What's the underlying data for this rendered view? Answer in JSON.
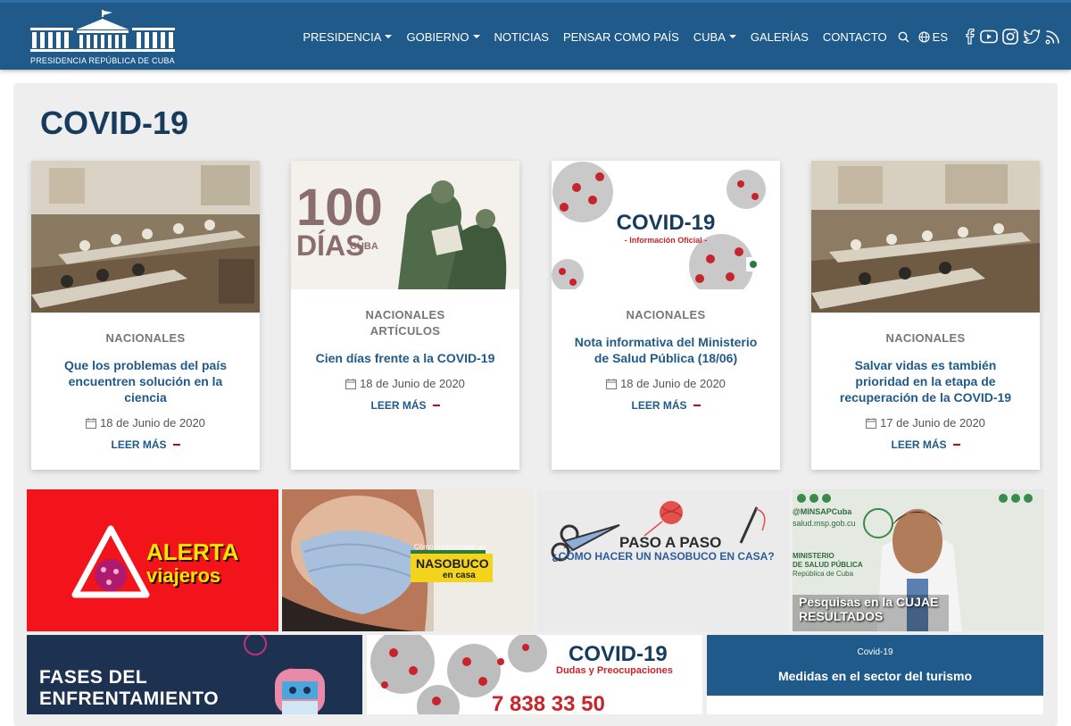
{
  "header": {
    "logo_text": "PRESIDENCIA REPÚBLICA DE CUBA",
    "nav": [
      {
        "label": "PRESIDENCIA",
        "dropdown": true
      },
      {
        "label": "GOBIERNO",
        "dropdown": true
      },
      {
        "label": "NOTICIAS",
        "dropdown": false
      },
      {
        "label": "PENSAR COMO PAÍS",
        "dropdown": false
      },
      {
        "label": "CUBA",
        "dropdown": true
      },
      {
        "label": "GALERÍAS",
        "dropdown": false
      },
      {
        "label": "CONTACTO",
        "dropdown": false
      }
    ],
    "lang": "ES",
    "icons": [
      "search-icon",
      "globe-icon",
      "facebook-icon",
      "youtube-icon",
      "instagram-icon",
      "twitter-icon",
      "rss-icon"
    ]
  },
  "page": {
    "title": "COVID-19"
  },
  "cards": [
    {
      "category": "NACIONALES",
      "category2": "",
      "title": "Que los problemas del país encuentren solución en la ciencia",
      "date": "18 de Junio de 2020",
      "more": "LEER MÁS"
    },
    {
      "category": "NACIONALES",
      "category2": "ARTÍCULOS",
      "title": "Cien días frente a la COVID-19",
      "date": "18 de Junio de 2020",
      "more": "LEER MÁS",
      "image_text": {
        "big": "100",
        "days": "DÍAS",
        "country": "CUBA"
      }
    },
    {
      "category": "NACIONALES",
      "category2": "",
      "title": "Nota informativa del Ministerio de Salud Pública (18/06)",
      "date": "18 de Junio de 2020",
      "more": "LEER MÁS",
      "image_text": {
        "big": "COVID-19",
        "sub": "- Información Oficial -"
      }
    },
    {
      "category": "NACIONALES",
      "category2": "",
      "title": "Salvar vidas es también prioridad en la etapa de recuperación de la COVID-19",
      "date": "17 de Junio de 2020",
      "more": "LEER MÁS"
    }
  ],
  "banners": {
    "alerta": {
      "line1": "ALERTA",
      "line2": "viajeros"
    },
    "nasobuco": {
      "small": "Cómo confeccionar un",
      "big": "NASOBUCO",
      "sub": "en casa"
    },
    "paso": {
      "line1": "PASO A PASO",
      "line2": "¿CÓMO HACER UN NASOBUCO EN CASA?"
    },
    "pesquisas": {
      "line1": "Pesquisas en la CUJAE",
      "line2": "RESULTADOS",
      "handle": "@MINSAPCuba",
      "site": "salud.msp.gob.cu",
      "ministry1": "MINISTERIO",
      "ministry2": "DE SALUD PÚBLICA",
      "ministry3": "República de Cuba"
    },
    "fases": {
      "line1": "FASES DEL",
      "line2": "ENFRENTAMIENTO"
    },
    "dudas": {
      "title": "COVID-19",
      "sub": "Dudas y Preocupaciones",
      "phone": "7 838 33 50"
    },
    "turismo": {
      "small": "Covid-19",
      "title": "Medidas en el sector del turismo"
    }
  },
  "colors": {
    "header": "#1f5a8b",
    "title": "#163b5c",
    "accent": "#d0021b"
  }
}
